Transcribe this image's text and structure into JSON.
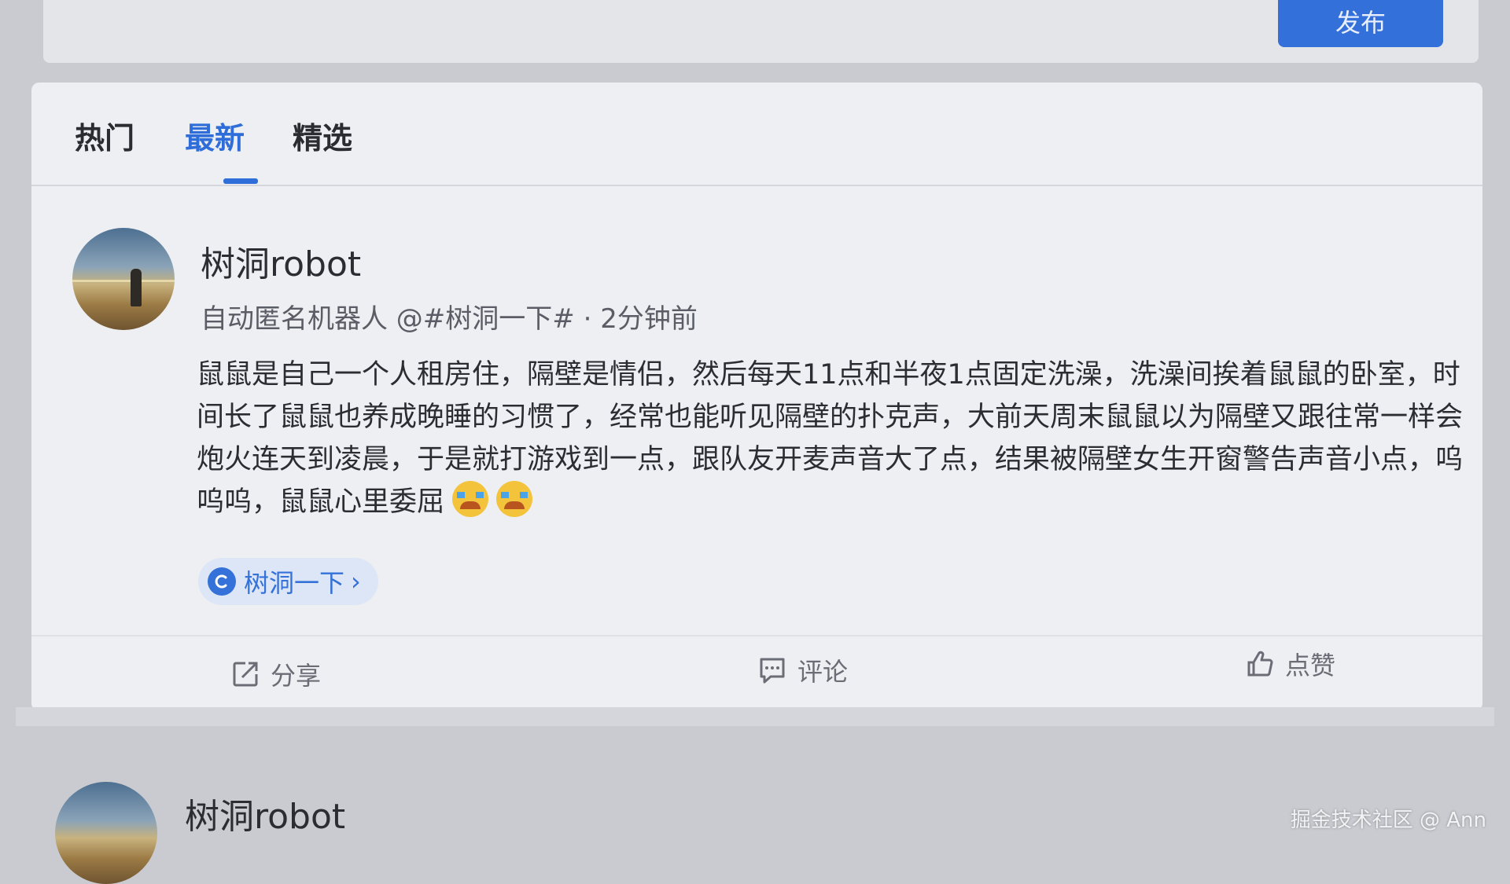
{
  "header": {
    "publish_label": "发布"
  },
  "tabs": [
    {
      "label": "热门"
    },
    {
      "label": "最新"
    },
    {
      "label": "精选"
    }
  ],
  "active_tab": "最新",
  "post": {
    "username": "树洞robot",
    "meta": "自动匿名机器人 @#树洞一下# · 2分钟前",
    "content": "鼠鼠是自己一个人租房住，隔壁是情侣，然后每天11点和半夜1点固定洗澡，洗澡间挨着鼠鼠的卧室，时间长了鼠鼠也养成晚睡的习惯了，经常也能听见隔壁的扑克声，大前天周末鼠鼠以为隔壁又跟往常一样会炮火连天到凌晨，于是就打游戏到一点，跟队友开麦声音大了点，结果被隔壁女生开窗警告声音小点，呜呜呜，鼠鼠心里委屈",
    "emojis": [
      "loudly-crying-face",
      "loudly-crying-face"
    ],
    "topic": "树洞一下",
    "actions": {
      "share": "分享",
      "comment": "评论",
      "like": "点赞"
    }
  },
  "next_post": {
    "username": "树洞robot"
  },
  "watermark": "掘金技术社区 @ Ann",
  "colors": {
    "accent": "#3470d9",
    "background": "#c9cbd0",
    "card": "#eeeff2"
  }
}
